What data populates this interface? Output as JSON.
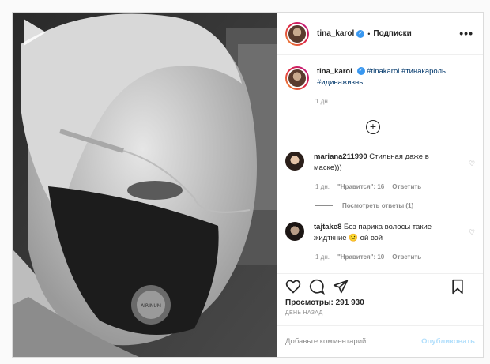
{
  "post": {
    "author": "tina_karol",
    "separator": "•",
    "follow_label": "Подписки",
    "more_label": "•••",
    "caption_user": "tina_karol",
    "caption_text": "#tinakarol #тинакароль #идинажизнь",
    "caption_time": "1 дн.",
    "add_label": "+"
  },
  "comments": [
    {
      "user": "mariana211990",
      "text": "Стильная даже в маске)))",
      "time": "1 дн.",
      "likes": "\"Нравится\": 16",
      "reply": "Ответить",
      "view_replies": "Посмотреть ответы (1)"
    },
    {
      "user": "tajtake8",
      "text": "Без парика волосы такие жидткние 🙁 ой вэй",
      "time": "1 дн.",
      "likes": "\"Нравится\": 10",
      "reply": "Ответить"
    }
  ],
  "stats": {
    "views": "Просмотры: 291 930",
    "ago": "ДЕНЬ НАЗАД"
  },
  "composer": {
    "placeholder": "Добавьте комментарий...",
    "publish": "Опубликовать"
  },
  "mask_logo": "AIRINUM",
  "icons": {
    "play": "play-icon",
    "more": "more-icon",
    "verified": "verified-icon",
    "like": "heart-icon",
    "comment": "comment-icon",
    "share": "share-icon",
    "save": "bookmark-icon"
  }
}
